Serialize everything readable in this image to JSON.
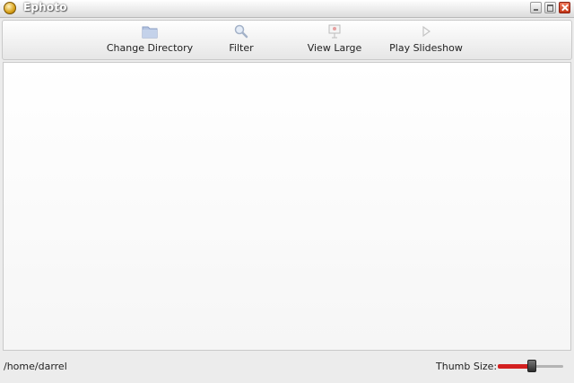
{
  "window": {
    "title": "Ephoto",
    "app_icon": "ephoto-app-icon",
    "controls": [
      "minimize-icon",
      "maximize-icon",
      "close-icon"
    ]
  },
  "toolbar": {
    "items": [
      {
        "label": "Change Directory",
        "icon": "folder-icon"
      },
      {
        "label": "Filter",
        "icon": "magnifier-icon"
      },
      {
        "label": "View Large",
        "icon": "presentation-icon"
      },
      {
        "label": "Play Slideshow",
        "icon": "play-icon"
      }
    ]
  },
  "statusbar": {
    "path": "/home/darrel",
    "thumb_size_label": "Thumb Size:",
    "thumb_size_fraction": 0.52
  },
  "colors": {
    "slider_fill": "#d32020",
    "toolbar_icon": "#a8b8d8"
  }
}
